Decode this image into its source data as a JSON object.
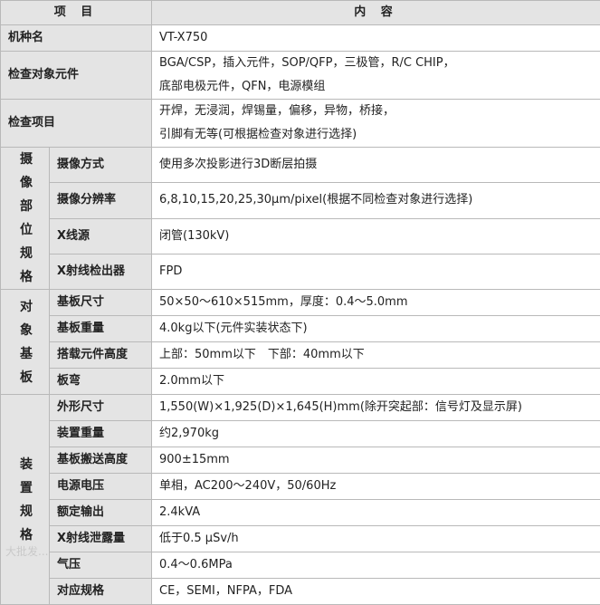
{
  "header": {
    "item": "项 目",
    "content": "内 容"
  },
  "rows_top": [
    {
      "label": "机种名",
      "value": "VT-X750"
    },
    {
      "label": "检查对象元件",
      "lines": [
        "BGA/CSP，插入元件，SOP/QFP，三极管，R/C CHIP，",
        "底部电极元件，QFN，电源模组"
      ]
    },
    {
      "label": "检查项目",
      "lines": [
        "开焊，无浸润，焊锡量，偏移，异物，桥接，",
        "引脚有无等(可根据检查对象进行选择)"
      ]
    }
  ],
  "groups": [
    {
      "name_lines": [
        "摄 像",
        "部 位",
        "规 格"
      ],
      "rows": [
        {
          "label": "摄像方式",
          "value": "使用多次投影进行3D断层拍摄"
        },
        {
          "label": "摄像分辨率",
          "value": "6,8,10,15,20,25,30μm/pixel(根据不同检查对象进行选择)"
        },
        {
          "label": "X线源",
          "value": "闭管(130kV)"
        },
        {
          "label": "X射线检出器",
          "value": "FPD"
        }
      ]
    },
    {
      "name_lines": [
        "对 象",
        "基 板"
      ],
      "rows": [
        {
          "label": "基板尺寸",
          "value": "50×50～610×515mm，厚度：0.4～5.0mm"
        },
        {
          "label": "基板重量",
          "value": "4.0kg以下(元件实装状态下)"
        },
        {
          "label": "搭载元件高度",
          "value": "上部：50mm以下　下部：40mm以下"
        },
        {
          "label": "板弯",
          "value": "2.0mm以下"
        }
      ]
    },
    {
      "name_lines": [
        "装 置",
        "规 格"
      ],
      "rows": [
        {
          "label": "外形尺寸",
          "value": "1,550(W)×1,925(D)×1,645(H)mm(除开突起部：信号灯及显示屏)"
        },
        {
          "label": "装置重量",
          "value": "约2,970kg"
        },
        {
          "label": "基板搬送高度",
          "value": "900±15mm"
        },
        {
          "label": "电源电压",
          "value": "单相，AC200～240V，50/60Hz"
        },
        {
          "label": "额定输出",
          "value": "2.4kVA"
        },
        {
          "label": "X射线泄露量",
          "value": "低于0.5 μSv/h"
        },
        {
          "label": "气压",
          "value": "0.4～0.6MPa"
        },
        {
          "label": "对应规格",
          "value": "CE，SEMI，NFPA，FDA"
        }
      ]
    }
  ],
  "watermark": "大批发..."
}
